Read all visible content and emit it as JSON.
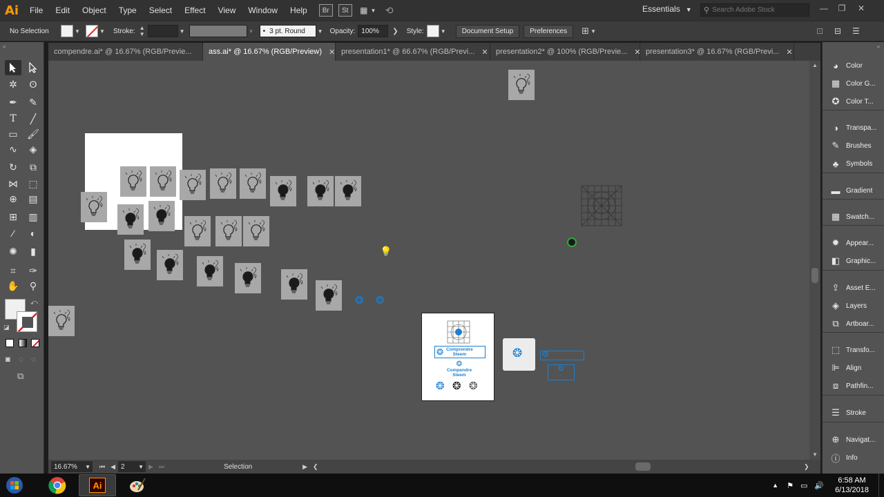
{
  "app": {
    "logo": "Ai",
    "menu": [
      "File",
      "Edit",
      "Object",
      "Type",
      "Select",
      "Effect",
      "View",
      "Window",
      "Help"
    ],
    "bridge_label": "Br",
    "stock_label": "St",
    "workspace": "Essentials",
    "search_placeholder": "Search Adobe Stock"
  },
  "control_bar": {
    "selection": "No Selection",
    "stroke_label": "Stroke:",
    "brush": "3 pt. Round",
    "opacity_label": "Opacity:",
    "opacity_value": "100%",
    "style_label": "Style:",
    "document_setup": "Document Setup",
    "preferences": "Preferences"
  },
  "tabs": [
    {
      "label": "compendre.ai* @ 16.67% (RGB/Previe..."
    },
    {
      "label": "ass.ai* @ 16.67% (RGB/Preview)"
    },
    {
      "label": "presentation1* @ 66.67% (RGB/Previ..."
    },
    {
      "label": "presentation2* @ 100% (RGB/Previe..."
    },
    {
      "label": "presentation3* @ 16.67% (RGB/Previ..."
    }
  ],
  "active_tab": 1,
  "artwork": {
    "logo_text_line1": "Comprendre",
    "logo_text_line2": "Steem",
    "logo_text_alt1": "Compendre",
    "logo_text_alt2": "Steem"
  },
  "status": {
    "zoom": "16.67%",
    "artboard": "2",
    "tool": "Selection"
  },
  "panels": [
    {
      "label": "Color",
      "icon": "color-icon"
    },
    {
      "label": "Color G...",
      "icon": "color-guide-icon"
    },
    {
      "label": "Color T...",
      "icon": "color-themes-icon"
    },
    {
      "label": "Transpa...",
      "icon": "transparency-icon"
    },
    {
      "label": "Brushes",
      "icon": "brushes-icon"
    },
    {
      "label": "Symbols",
      "icon": "symbols-icon"
    },
    {
      "label": "Gradient",
      "icon": "gradient-icon"
    },
    {
      "label": "Swatch...",
      "icon": "swatches-icon"
    },
    {
      "label": "Appear...",
      "icon": "appearance-icon"
    },
    {
      "label": "Graphic...",
      "icon": "graphic-styles-icon"
    },
    {
      "label": "Asset E...",
      "icon": "asset-export-icon"
    },
    {
      "label": "Layers",
      "icon": "layers-icon"
    },
    {
      "label": "Artboar...",
      "icon": "artboards-icon"
    },
    {
      "label": "Transfo...",
      "icon": "transform-icon"
    },
    {
      "label": "Align",
      "icon": "align-icon"
    },
    {
      "label": "Pathfin...",
      "icon": "pathfinder-icon"
    },
    {
      "label": "Stroke",
      "icon": "stroke-icon"
    },
    {
      "label": "Navigat...",
      "icon": "navigator-icon"
    },
    {
      "label": "Info",
      "icon": "info-icon"
    }
  ],
  "taskbar": {
    "time": "6:58 AM",
    "date": "6/13/2018",
    "ai_label": "Ai"
  },
  "colors": {
    "accent_orange": "#ff9a00",
    "steem_blue": "#1a7fd0",
    "canvas": "#535353"
  }
}
